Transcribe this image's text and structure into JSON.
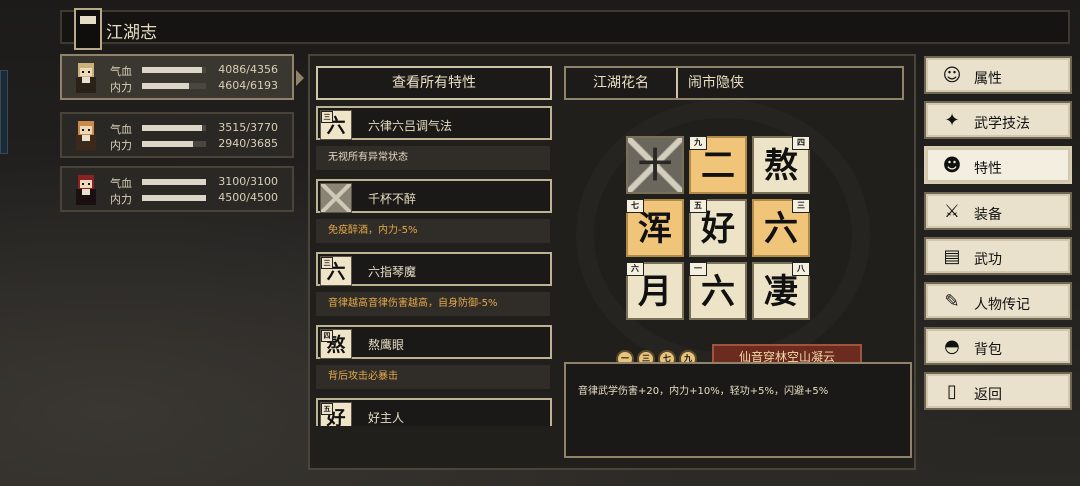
{
  "window": {
    "title": "江湖志"
  },
  "characters": [
    {
      "hp_label": "气血",
      "hp": "4086/4356",
      "hp_frac": 0.94,
      "mp_label": "内力",
      "mp": "4604/6193",
      "mp_frac": 0.74,
      "selected": true
    },
    {
      "hp_label": "气血",
      "hp": "3515/3770",
      "hp_frac": 0.93,
      "mp_label": "内力",
      "mp": "2940/3685",
      "mp_frac": 0.8,
      "selected": false
    },
    {
      "hp_label": "气血",
      "hp": "3100/3100",
      "hp_frac": 1.0,
      "mp_label": "内力",
      "mp": "4500/4500",
      "mp_frac": 1.0,
      "selected": false
    }
  ],
  "traits": {
    "view_all": "查看所有特性",
    "items": [
      {
        "icon_char": "六",
        "badge": "三",
        "name": "六律六吕调气法",
        "desc": "无视所有异常状态",
        "desc_color": "white",
        "icon_type": "char"
      },
      {
        "icon_char": "",
        "badge": "",
        "name": "千杯不醉",
        "desc": "免疫醉酒，内力-5%",
        "desc_color": "gold",
        "icon_type": "chain"
      },
      {
        "icon_char": "六",
        "badge": "三",
        "name": "六指琴魔",
        "desc": "音律越高音律伤害越高，自身防御-5%",
        "desc_color": "gold",
        "icon_type": "char"
      },
      {
        "icon_char": "熬",
        "badge": "四",
        "name": "熬鹰眼",
        "desc": "背后攻击必暴击",
        "desc_color": "gold",
        "icon_type": "char"
      },
      {
        "icon_char": "好",
        "badge": "五",
        "name": "好主人",
        "desc": "",
        "desc_color": "gold",
        "icon_type": "char"
      }
    ]
  },
  "nickname": {
    "label": "江湖花名",
    "value": "闹市隐侠"
  },
  "grid": [
    {
      "char": "十",
      "badge": "",
      "style": "crossed"
    },
    {
      "char": "二",
      "badge": "九",
      "style": "gold"
    },
    {
      "char": "熬",
      "badge": "四",
      "style": "plain"
    },
    {
      "char": "浑",
      "badge": "七",
      "style": "gold"
    },
    {
      "char": "好",
      "badge": "五",
      "style": "plain"
    },
    {
      "char": "六",
      "badge": "三",
      "style": "gold"
    },
    {
      "char": "月",
      "badge": "六",
      "style": "plain"
    },
    {
      "char": "六",
      "badge": "一",
      "style": "plain"
    },
    {
      "char": "凄",
      "badge": "八",
      "style": "plain"
    }
  ],
  "combo": {
    "icons": [
      "一",
      "三",
      "七",
      "九"
    ],
    "name": "仙音穿林空山凝云",
    "effect": "音律武学伤害+20，内力+10%，轻功+5%，闪避+5%"
  },
  "menu": [
    {
      "label": "属性",
      "icon": "person-icon",
      "glyph": "☺",
      "active": false
    },
    {
      "label": "武学技法",
      "icon": "skills-icon",
      "glyph": "✦",
      "active": false
    },
    {
      "label": "特性",
      "icon": "trait-icon",
      "glyph": "☻",
      "active": true
    },
    {
      "label": "装备",
      "icon": "sword-icon",
      "glyph": "⚔",
      "active": false
    },
    {
      "label": "武功",
      "icon": "book-icon",
      "glyph": "▤",
      "active": false
    },
    {
      "label": "人物传记",
      "icon": "scroll-icon",
      "glyph": "✎",
      "active": false
    },
    {
      "label": "背包",
      "icon": "bag-icon",
      "glyph": "◓",
      "active": false
    },
    {
      "label": "返回",
      "icon": "door-icon",
      "glyph": "▯",
      "active": false
    }
  ]
}
